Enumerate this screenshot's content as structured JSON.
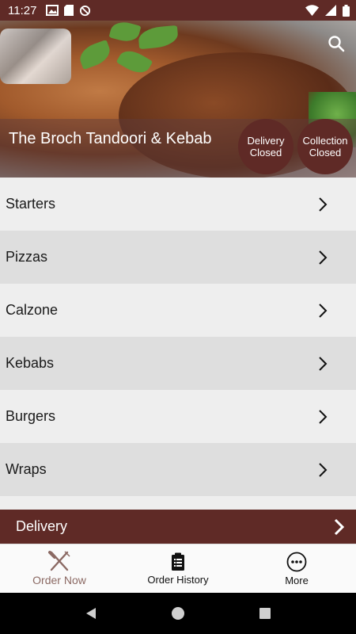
{
  "status_bar": {
    "time": "11:27"
  },
  "header": {
    "restaurant_name": "The Broch Tandoori & Kebab",
    "delivery_status": {
      "line1": "Delivery",
      "line2": "Closed"
    },
    "collection_status": {
      "line1": "Collection",
      "line2": "Closed"
    }
  },
  "menu": {
    "items": [
      {
        "label": "Starters"
      },
      {
        "label": "Pizzas"
      },
      {
        "label": "Calzone"
      },
      {
        "label": "Kebabs"
      },
      {
        "label": "Burgers"
      },
      {
        "label": "Wraps"
      }
    ]
  },
  "delivery_bar": {
    "label": "Delivery"
  },
  "tabs": [
    {
      "label": "Order Now",
      "icon": "fork-knife-icon",
      "active": true
    },
    {
      "label": "Order History",
      "icon": "clipboard-icon",
      "active": false
    },
    {
      "label": "More",
      "icon": "more-dots-icon",
      "active": false
    }
  ],
  "colors": {
    "brand": "#5f2a26",
    "active_tab": "#8b6963"
  }
}
